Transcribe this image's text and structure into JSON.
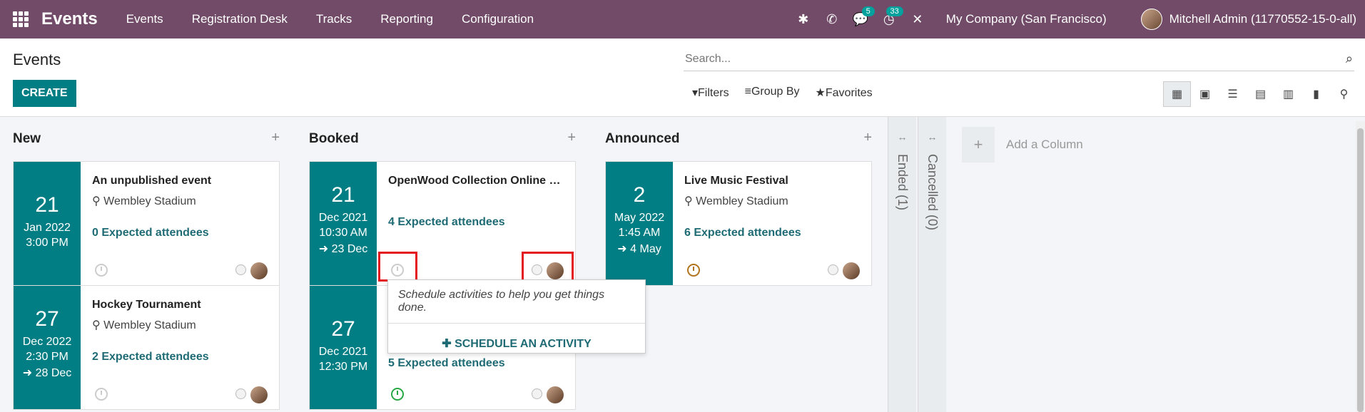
{
  "topbar": {
    "app_name": "Events",
    "menu": [
      "Events",
      "Registration Desk",
      "Tracks",
      "Reporting",
      "Configuration"
    ],
    "messages_badge": "5",
    "activities_badge": "33",
    "company": "My Company (San Francisco)",
    "user": "Mitchell Admin (11770552-15-0-all)"
  },
  "control": {
    "breadcrumb": "Events",
    "create_label": "CREATE",
    "search_placeholder": "Search...",
    "filters_label": "Filters",
    "group_by_label": "Group By",
    "favorites_label": "Favorites"
  },
  "columns": [
    {
      "title": "New",
      "cards": [
        {
          "day": "21",
          "month": "Jan 2022",
          "time": "3:00 PM",
          "end": "",
          "title": "An unpublished event",
          "location": "Wembley Stadium",
          "attendees": "0 Expected attendees",
          "activity": "gray"
        },
        {
          "day": "27",
          "month": "Dec 2022",
          "time": "2:30 PM",
          "end": "28 Dec",
          "title": "Hockey Tournament",
          "location": "Wembley Stadium",
          "attendees": "2 Expected attendees",
          "activity": "gray"
        }
      ]
    },
    {
      "title": "Booked",
      "cards": [
        {
          "day": "21",
          "month": "Dec 2021",
          "time": "10:30 AM",
          "end": "23 Dec",
          "title": "OpenWood Collection Online Reveal",
          "location": "",
          "attendees": "4 Expected attendees",
          "activity": "gray"
        },
        {
          "day": "27",
          "month": "Dec 2021",
          "time": "12:30 PM",
          "end": "",
          "title": "",
          "location": "",
          "attendees": "5 Expected attendees",
          "activity": "green"
        }
      ]
    },
    {
      "title": "Announced",
      "cards": [
        {
          "day": "2",
          "month": "May 2022",
          "time": "1:45 AM",
          "end": "4 May",
          "title": "Live Music Festival",
          "location": "Wembley Stadium",
          "attendees": "6 Expected attendees",
          "activity": "orange"
        }
      ]
    }
  ],
  "folded": [
    "Ended (1)",
    "Cancelled (0)"
  ],
  "add_column_label": "Add a Column",
  "popover": {
    "text": "Schedule activities to help you get things done.",
    "button": "SCHEDULE AN ACTIVITY"
  }
}
